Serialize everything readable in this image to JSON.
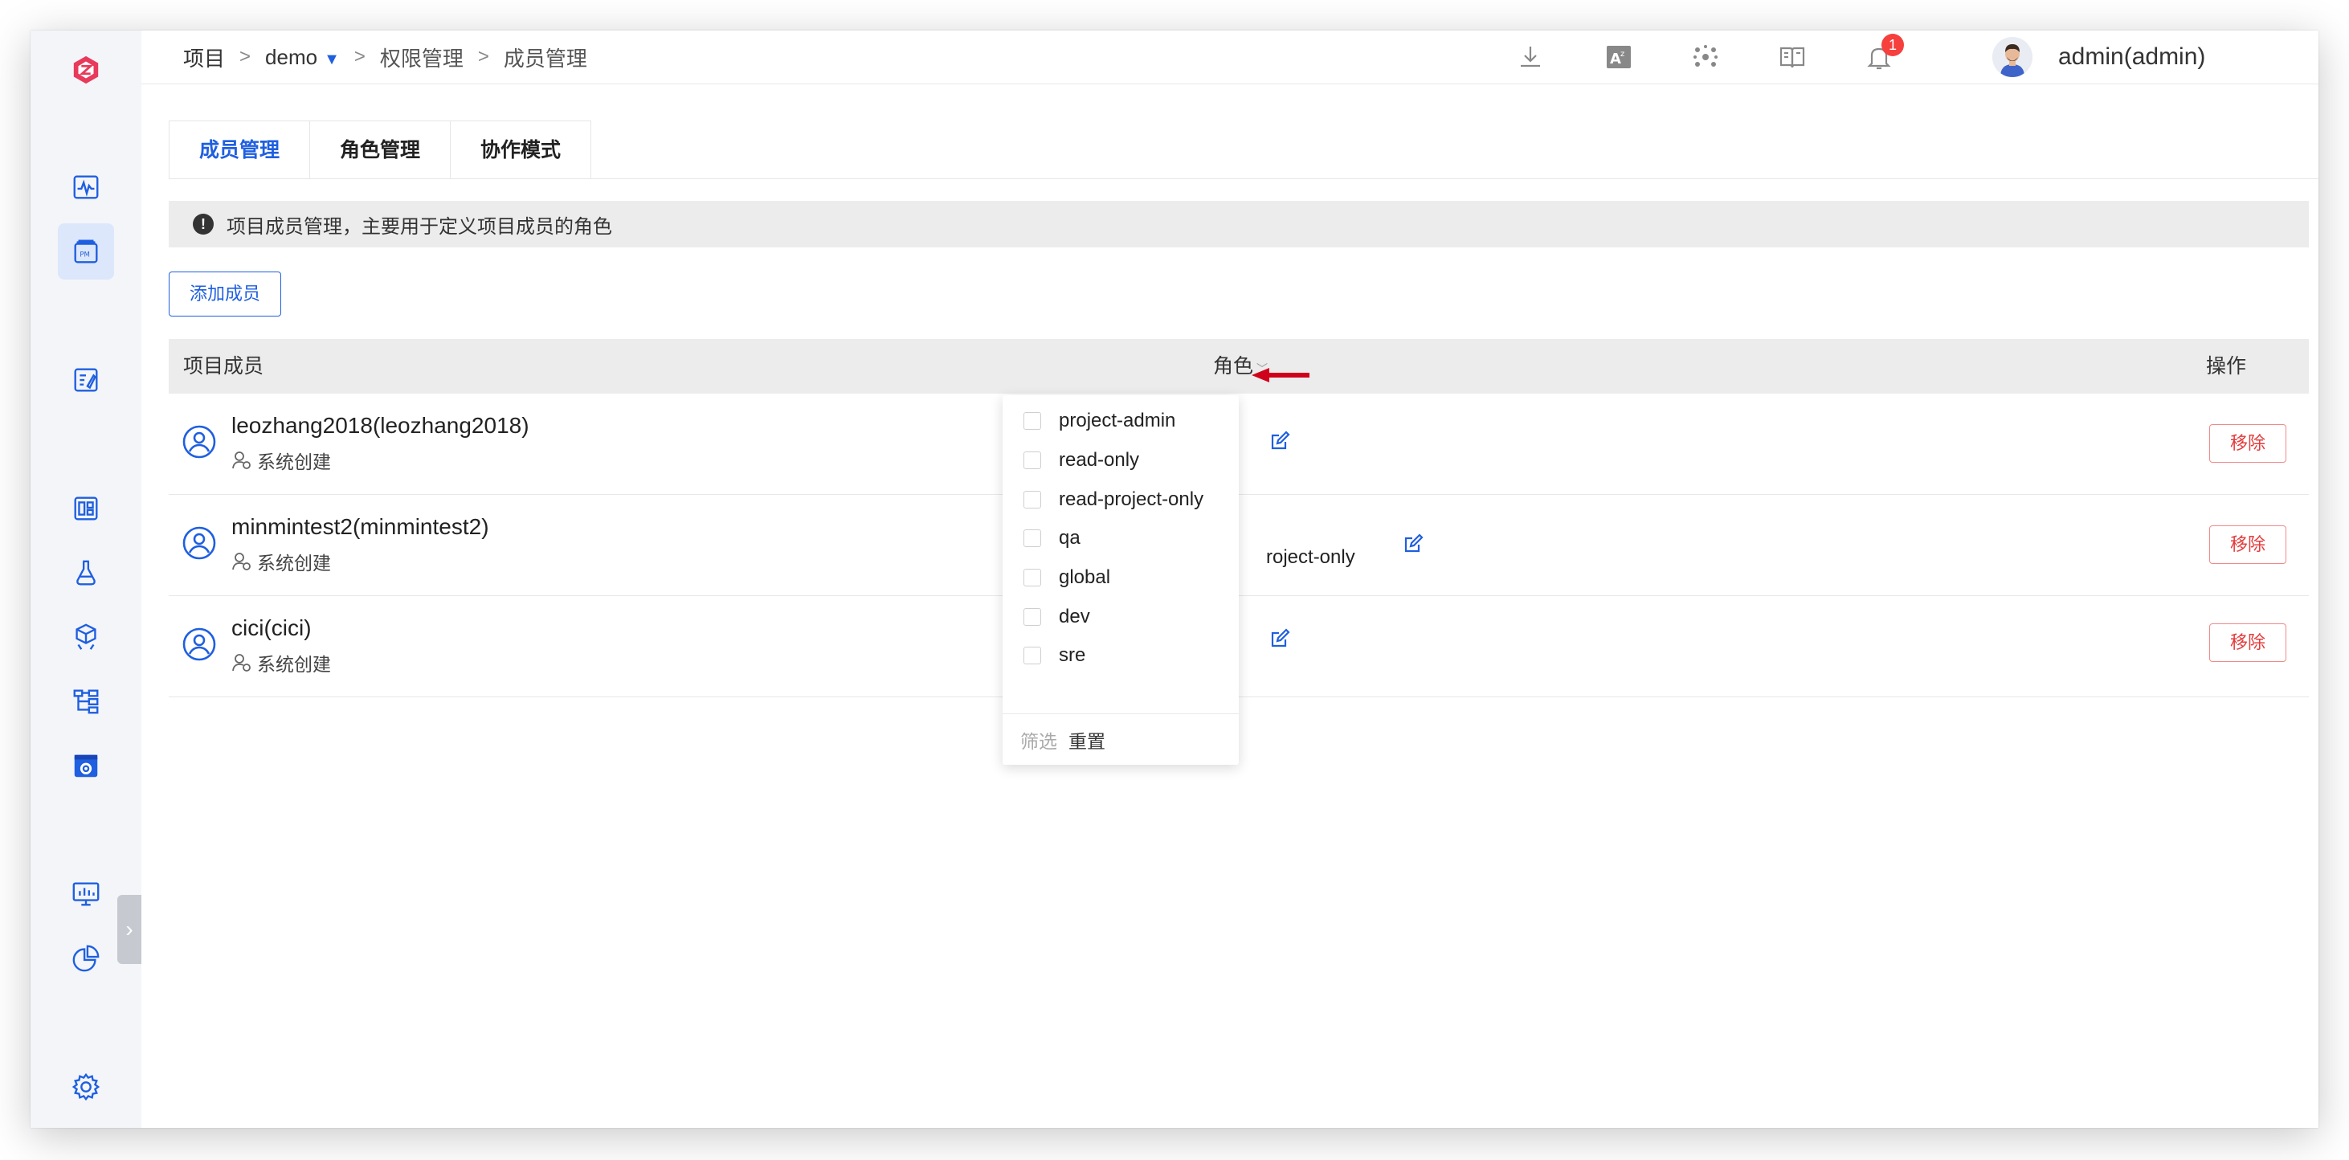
{
  "breadcrumb": {
    "root": "项目",
    "project": "demo",
    "section": "权限管理",
    "page": "成员管理",
    "separator": ">"
  },
  "header": {
    "notification_count": "1",
    "username": "admin(admin)",
    "icons": [
      "download-icon",
      "translate-icon",
      "network-icon",
      "docs-icon",
      "bell-icon",
      "more-vertical-icon"
    ]
  },
  "sidebar": {
    "items": [
      "logo-icon",
      "activity-icon",
      "project-icon",
      "edit-icon",
      "dashboard-icon",
      "flask-icon",
      "package-icon",
      "workflow-icon",
      "settings-box-icon",
      "monitor-icon",
      "pie-chart-icon",
      "gear-icon"
    ],
    "active": "project-icon"
  },
  "tabs": [
    {
      "label": "成员管理",
      "active": true
    },
    {
      "label": "角色管理",
      "active": false
    },
    {
      "label": "协作模式",
      "active": false
    }
  ],
  "alert": {
    "text": "项目成员管理，主要用于定义项目成员的角色"
  },
  "add_member_label": "添加成员",
  "table": {
    "col_member": "项目成员",
    "col_role": "角色",
    "col_action": "操作",
    "rows": [
      {
        "name": "leozhang2018(leozhang2018)",
        "source": "系统创建",
        "role": "",
        "action": "移除"
      },
      {
        "name": "minmintest2(minmintest2)",
        "source": "系统创建",
        "role": "roject-only",
        "action": "移除"
      },
      {
        "name": "cici(cici)",
        "source": "系统创建",
        "role": "",
        "action": "移除"
      }
    ]
  },
  "role_filter": {
    "options": [
      "project-admin",
      "read-only",
      "read-project-only",
      "qa",
      "global",
      "dev",
      "sre"
    ],
    "filter_label": "筛选",
    "reset_label": "重置"
  },
  "colors": {
    "accent": "#1f5fe0",
    "danger": "#e33b3b",
    "badge": "#f5403e",
    "arrow": "#d0021b"
  }
}
